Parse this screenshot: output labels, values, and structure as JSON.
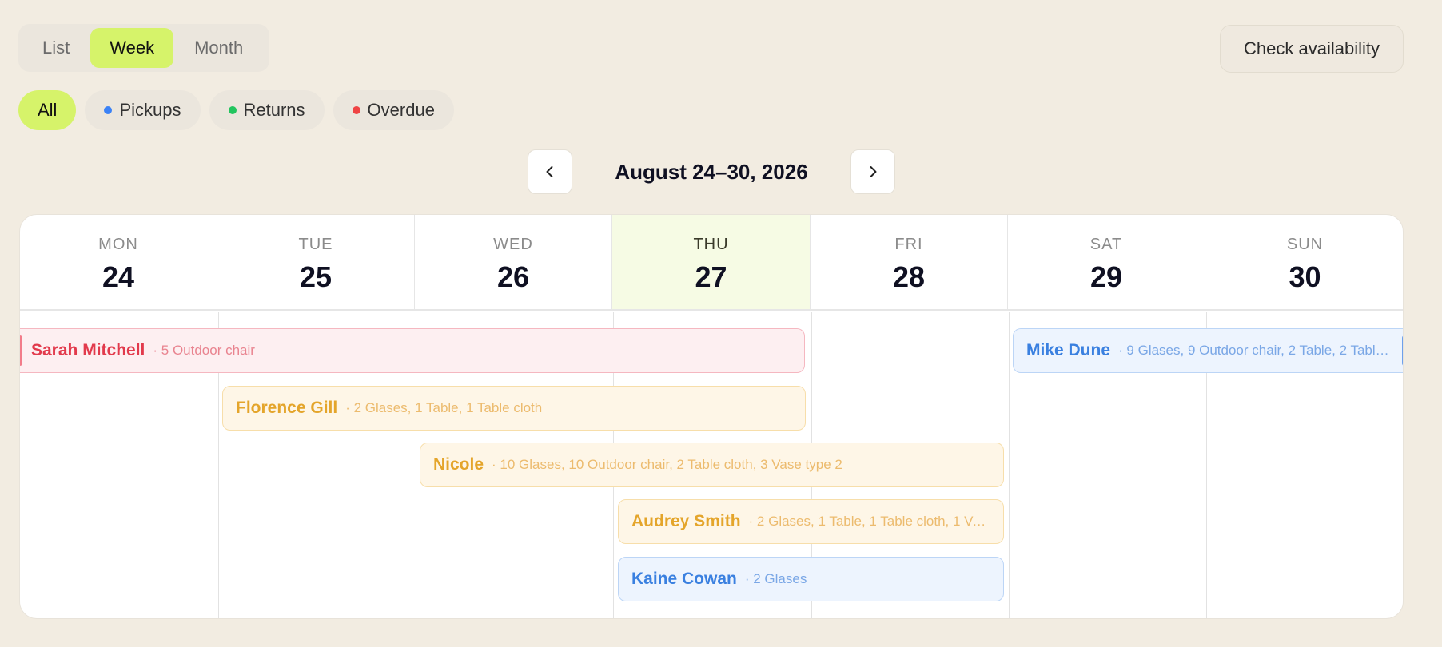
{
  "views": {
    "list_label": "List",
    "week_label": "Week",
    "month_label": "Month",
    "active": "Week"
  },
  "check_availability_label": "Check availability",
  "filters": {
    "all": "All",
    "pickups": "Pickups",
    "returns": "Returns",
    "overdue": "Overdue",
    "colors": {
      "pickups": "#3b82f6",
      "returns": "#22c55e",
      "overdue": "#ef4444"
    }
  },
  "nav": {
    "title": "August 24–30, 2026",
    "prev_icon": "chevron-left-icon",
    "next_icon": "chevron-right-icon"
  },
  "days": [
    {
      "name": "MON",
      "num": "24"
    },
    {
      "name": "TUE",
      "num": "25"
    },
    {
      "name": "WED",
      "num": "26"
    },
    {
      "name": "THU",
      "num": "27",
      "today": true
    },
    {
      "name": "FRI",
      "num": "28"
    },
    {
      "name": "SAT",
      "num": "29"
    },
    {
      "name": "SUN",
      "num": "30"
    }
  ],
  "events": [
    {
      "name": "Sarah Mitchell",
      "items": "· 5 Outdoor chair",
      "color": "red",
      "start_day": "MON",
      "end_day": "THU"
    },
    {
      "name": "Florence Gill",
      "items": "· 2 Glases, 1 Table, 1 Table cloth",
      "color": "yellow",
      "start_day": "TUE",
      "end_day": "THU"
    },
    {
      "name": "Nicole",
      "items": "· 10 Glases, 10 Outdoor chair, 2 Table cloth, 3 Vase type 2",
      "color": "yellow",
      "start_day": "WED",
      "end_day": "FRI"
    },
    {
      "name": "Audrey Smith",
      "items": "· 2 Glases, 1 Table, 1 Table cloth, 1 Va…",
      "color": "yellow",
      "start_day": "THU",
      "end_day": "FRI"
    },
    {
      "name": "Kaine Cowan",
      "items": "· 2 Glases",
      "color": "blue",
      "start_day": "THU",
      "end_day": "FRI"
    },
    {
      "name": "Mike Dune",
      "items": "· 9 Glases, 9 Outdoor chair, 2 Table, 2 Tabl…",
      "color": "blue",
      "start_day": "SAT",
      "end_day": "SUN"
    }
  ]
}
